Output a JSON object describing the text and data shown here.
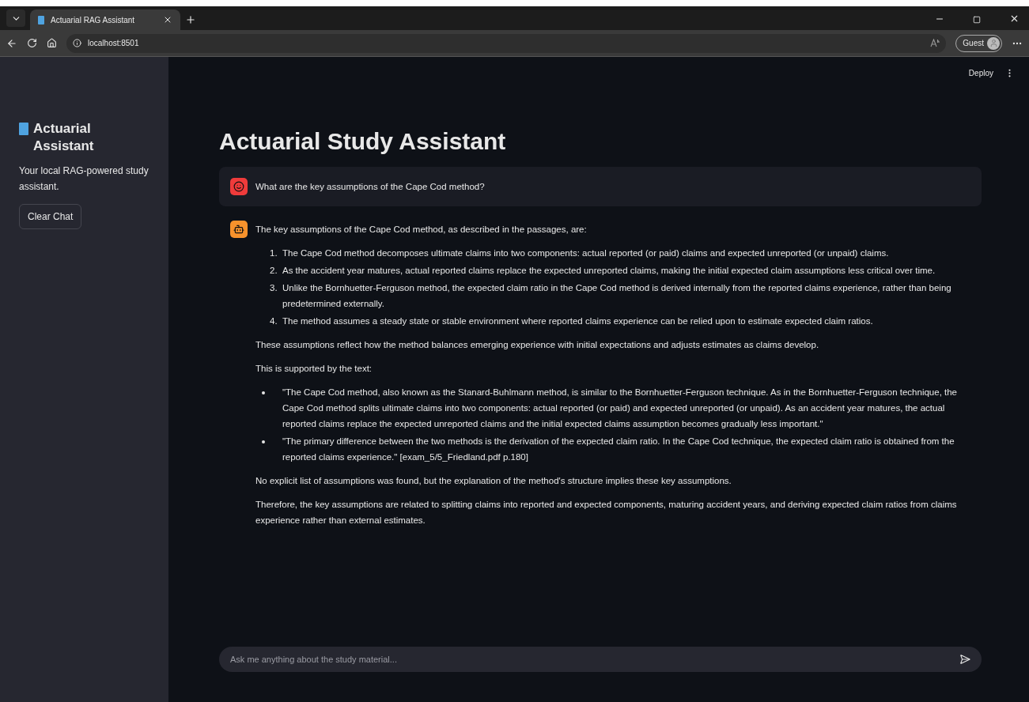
{
  "browser": {
    "tab": {
      "title": "Actuarial RAG Assistant",
      "selected": true
    },
    "url": "localhost:8501",
    "profile": "Guest"
  },
  "header": {
    "deploy": "Deploy"
  },
  "sidebar": {
    "title": "Actuarial Assistant",
    "caption": "Your local RAG-powered study assistant.",
    "button": "Clear Chat"
  },
  "main": {
    "title": "Actuarial Study Assistant",
    "messages": [
      {
        "kind": "user",
        "blocks": [
          {
            "kind": "paragraph",
            "text": "What are the key assumptions of the Cape Cod method?"
          }
        ]
      },
      {
        "kind": "assistant",
        "blocks": [
          {
            "kind": "paragraph",
            "text": "The key assumptions of the Cape Cod method, as described in the passages, are:"
          },
          {
            "kind": "ordered_list",
            "items": [
              {
                "number": "1.",
                "text": "The Cape Cod method decomposes ultimate claims into two components: actual reported (or paid) claims and expected unreported (or unpaid) claims."
              },
              {
                "number": "2.",
                "text": "As the accident year matures, actual reported claims replace the expected unreported claims, making the initial expected claim assumptions less critical over time."
              },
              {
                "number": "3.",
                "text": "Unlike the Bornhuetter-Ferguson method, the expected claim ratio in the Cape Cod method is derived internally from the reported claims experience, rather than being predetermined externally."
              },
              {
                "number": "4.",
                "text": "The method assumes a steady state or stable environment where reported claims experience can be relied upon to estimate expected claim ratios."
              }
            ]
          },
          {
            "kind": "paragraph",
            "text": "These assumptions reflect how the method balances emerging experience with initial expectations and adjusts estimates as claims develop."
          },
          {
            "kind": "paragraph",
            "text": "This is supported by the text:"
          },
          {
            "kind": "bullet_list",
            "items": [
              "\"The Cape Cod method, also known as the Stanard-Buhlmann method, is similar to the Bornhuetter-Ferguson technique. As in the Bornhuetter-Ferguson technique, the Cape Cod method splits ultimate claims into two components: actual reported (or paid) and expected unreported (or unpaid). As an accident year matures, the actual reported claims replace the expected unreported claims and the initial expected claims assumption becomes gradually less important.\"",
              "\"The primary difference between the two methods is the derivation of the expected claim ratio. In the Cape Cod technique, the expected claim ratio is obtained from the reported claims experience.\" [exam_5/5_Friedland.pdf p.180]"
            ]
          },
          {
            "kind": "paragraph",
            "text": "No explicit list of assumptions was found, but the explanation of the method's structure implies these key assumptions."
          },
          {
            "kind": "paragraph",
            "text": "Therefore, the key assumptions are related to splitting claims into reported and expected components, maturing accident years, and deriving expected claim ratios from claims experience rather than external estimates."
          }
        ]
      }
    ]
  },
  "chat_input": {
    "placeholder": "Ask me anything about the study material..."
  }
}
